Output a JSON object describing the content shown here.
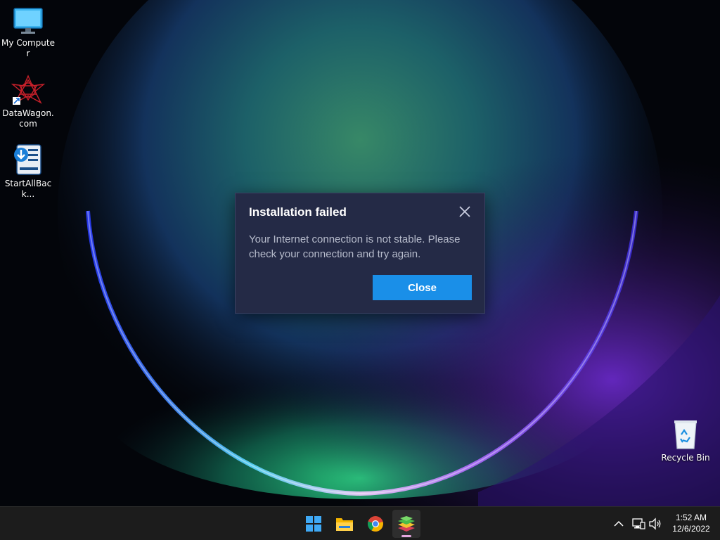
{
  "desktop": {
    "icons": [
      {
        "name": "my-computer-icon",
        "label": "My Computer"
      },
      {
        "name": "datawagon-icon",
        "label": "DataWagon.com"
      },
      {
        "name": "startallback-icon",
        "label": "StartAllBack..."
      },
      {
        "name": "recycle-bin-icon",
        "label": "Recycle Bin"
      }
    ]
  },
  "dialog": {
    "title": "Installation failed",
    "message": "Your Internet connection is not stable. Please check your connection and try again.",
    "close_label": "Close"
  },
  "taskbar": {
    "apps": [
      "start-icon",
      "file-explorer-icon",
      "chrome-icon",
      "bluestacks-icon"
    ],
    "active_app": "bluestacks-icon",
    "tray": {
      "icons": [
        "chevron-up-icon",
        "network-icon",
        "volume-icon"
      ],
      "time": "1:52 AM",
      "date": "12/6/2022"
    }
  },
  "colors": {
    "dialog_bg": "#242a46",
    "button_accent": "#1a8fe8",
    "taskbar_bg": "#1c1c1c"
  }
}
